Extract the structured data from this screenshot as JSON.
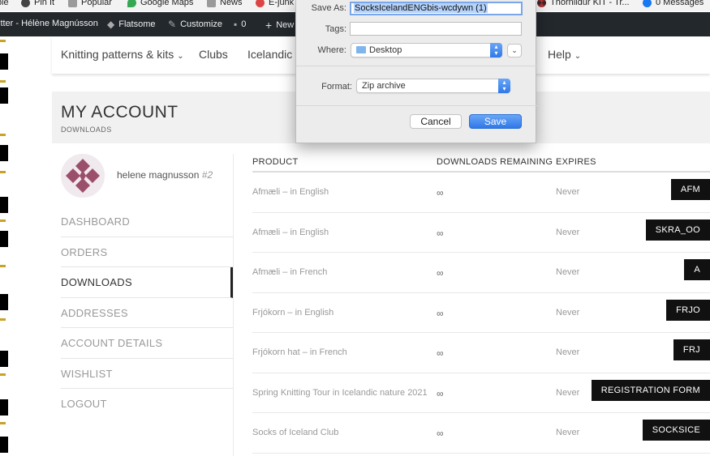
{
  "bookmarks": [
    {
      "label": "ble",
      "icon": "bookmark-icon",
      "color": "#888888"
    },
    {
      "label": "Pin It",
      "icon": "pin-icon",
      "color": "#444444"
    },
    {
      "label": "Popular",
      "icon": "folder-icon",
      "color": "#9a9a9a"
    },
    {
      "label": "Google Maps",
      "icon": "map-pin-icon",
      "color": "#34a853"
    },
    {
      "label": "News",
      "icon": "folder-icon",
      "color": "#9a9a9a"
    },
    {
      "label": "E-junk",
      "icon": "globe-icon",
      "color": "#d44"
    },
    {
      "label": "Thornildur KIT - Tr...",
      "icon": "wheel-icon",
      "color": "#c33"
    },
    {
      "label": "0 Messages",
      "icon": "facebook-icon",
      "color": "#1877f2"
    }
  ],
  "adminbar": {
    "site": "itter - Hélène Magnússon",
    "theme": "Flatsome",
    "customize": "Customize",
    "comments": "0",
    "new": "New"
  },
  "nav": {
    "items": [
      "Knitting patterns & kits",
      "Clubs",
      "Icelandic W",
      "Help"
    ]
  },
  "page": {
    "title": "MY ACCOUNT",
    "breadcrumb": "DOWNLOADS"
  },
  "user": {
    "name": "helene magnusson",
    "id": "#2"
  },
  "menu": [
    "DASHBOARD",
    "ORDERS",
    "DOWNLOADS",
    "ADDRESSES",
    "ACCOUNT DETAILS",
    "WISHLIST",
    "LOGOUT"
  ],
  "table": {
    "headers": [
      "PRODUCT",
      "DOWNLOADS REMAINING",
      "EXPIRES"
    ],
    "rows": [
      {
        "product": "Afmæli – in English",
        "remaining": "∞",
        "expires": "Never",
        "button": "AFM"
      },
      {
        "product": "Afmæli – in English",
        "remaining": "∞",
        "expires": "Never",
        "button": "SKRA_OO"
      },
      {
        "product": "Afmæli – in French",
        "remaining": "∞",
        "expires": "Never",
        "button": "A"
      },
      {
        "product": "Frjókorn – in English",
        "remaining": "∞",
        "expires": "Never",
        "button": "FRJO"
      },
      {
        "product": "Frjókorn hat – in French",
        "remaining": "∞",
        "expires": "Never",
        "button": "FRJ"
      },
      {
        "product": "Spring Knitting Tour in Icelandic nature 2021",
        "remaining": "∞",
        "expires": "Never",
        "button": "REGISTRATION FORM"
      },
      {
        "product": "Socks of Iceland Club",
        "remaining": "∞",
        "expires": "Never",
        "button": "SOCKSICE"
      }
    ]
  },
  "dialog": {
    "save_as_label": "Save As:",
    "save_as_value": "SocksIcelandENGbis-wcdywn (1)",
    "tags_label": "Tags:",
    "tags_value": "",
    "where_label": "Where:",
    "where_value": "Desktop",
    "format_label": "Format:",
    "format_value": "Zip archive",
    "cancel": "Cancel",
    "save": "Save"
  },
  "colors": {
    "accent": "#2e78e8",
    "admin_bar": "#23282d",
    "button": "#111111"
  }
}
